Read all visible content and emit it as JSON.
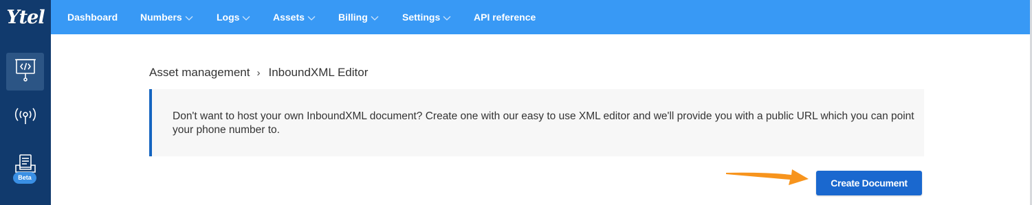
{
  "brand": {
    "logo_text": "Ytel"
  },
  "nav": {
    "items": [
      {
        "label": "Dashboard",
        "has_dropdown": false
      },
      {
        "label": "Numbers",
        "has_dropdown": true
      },
      {
        "label": "Logs",
        "has_dropdown": true
      },
      {
        "label": "Assets",
        "has_dropdown": true
      },
      {
        "label": "Billing",
        "has_dropdown": true
      },
      {
        "label": "Settings",
        "has_dropdown": true
      },
      {
        "label": "API reference",
        "has_dropdown": false
      }
    ]
  },
  "sidebar": {
    "items": [
      {
        "icon": "presentation-code-icon",
        "active": true
      },
      {
        "icon": "broadcast-icon",
        "active": false
      },
      {
        "icon": "document-inbox-icon",
        "active": false,
        "badge": "Beta"
      }
    ]
  },
  "breadcrumb": {
    "parent": "Asset management",
    "separator": "›",
    "current": "InboundXML Editor"
  },
  "info": {
    "text": "Don't want to host your own InboundXML document? Create one with our easy to use XML editor and we'll provide you with a public URL which you can point your phone number to."
  },
  "actions": {
    "create_label": "Create Document"
  },
  "colors": {
    "topbar": "#3899f5",
    "sidebar": "#113a6d",
    "primary_button": "#1a68cf",
    "info_border": "#1565c0",
    "arrow": "#f7941d"
  }
}
